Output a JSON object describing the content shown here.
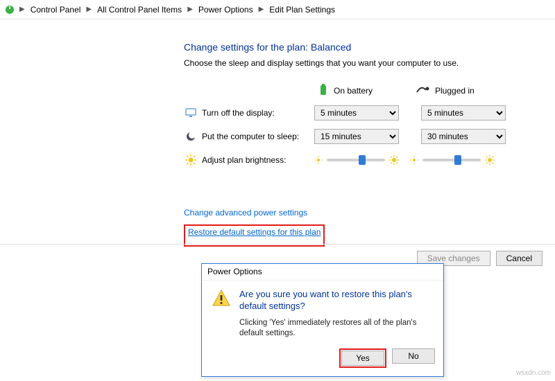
{
  "breadcrumb": {
    "items": [
      "Control Panel",
      "All Control Panel Items",
      "Power Options",
      "Edit Plan Settings"
    ]
  },
  "page": {
    "heading": "Change settings for the plan: Balanced",
    "sub": "Choose the sleep and display settings that you want your computer to use."
  },
  "columns": {
    "battery": "On battery",
    "plugged": "Plugged in"
  },
  "rows": {
    "display": {
      "label": "Turn off the display:",
      "battery": "5 minutes",
      "plugged": "5 minutes"
    },
    "sleep": {
      "label": "Put the computer to sleep:",
      "battery": "15 minutes",
      "plugged": "30 minutes"
    },
    "brightness": {
      "label": "Adjust plan brightness:"
    }
  },
  "links": {
    "advanced": "Change advanced power settings",
    "restore": "Restore default settings for this plan"
  },
  "buttons": {
    "save": "Save changes",
    "cancel": "Cancel"
  },
  "dialog": {
    "title": "Power Options",
    "message": "Are you sure you want to restore this plan's default settings?",
    "description": "Clicking 'Yes' immediately restores all of the plan's default settings.",
    "yes": "Yes",
    "no": "No"
  },
  "watermark": "wsxdn.com"
}
